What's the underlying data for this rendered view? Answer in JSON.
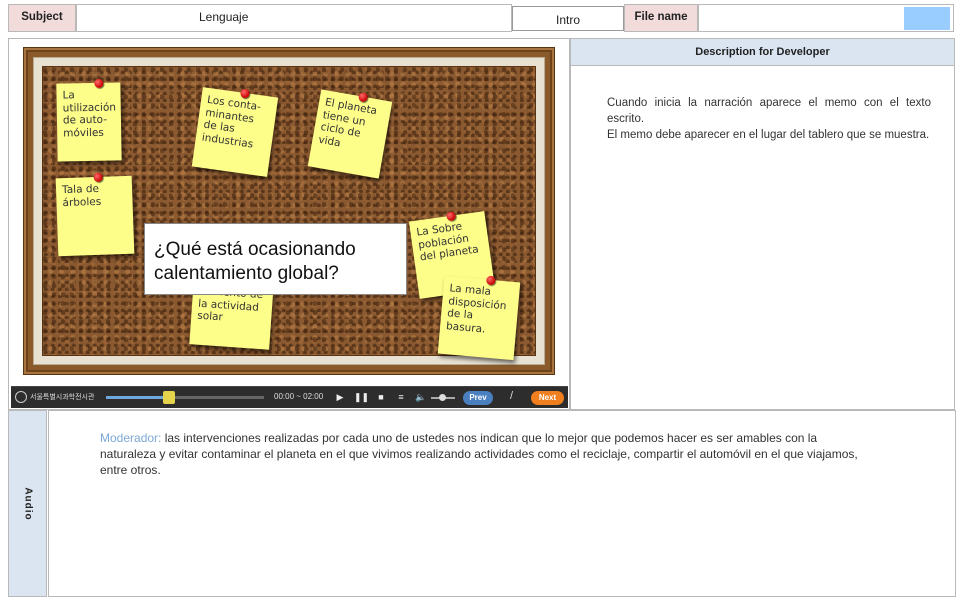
{
  "header": {
    "subject_label": "Subject",
    "subject_value": "Lenguaje",
    "intro": "Intro",
    "file_name_label": "File name",
    "file_name_value": ""
  },
  "description": {
    "title": "Description for Developer",
    "lines": [
      "Cuando inicia la narración aparece el memo con el texto escrito.",
      "El memo debe aparecer en el lugar del tablero que se muestra."
    ]
  },
  "board": {
    "question": "¿Qué está ocasionando calentamiento global?",
    "notes": [
      "La\nutilización\nde auto-\nmóviles",
      "Los conta-\nminantes\nde las\nindustrias",
      "El planeta\ntiene un\nciclo de\nvida",
      "Tala de\nárboles",
      "Aumento de\nla actividad\nsolar",
      "La Sobre\npoblación\ndel planeta",
      "La mala\ndisposición\nde la\nbasura."
    ]
  },
  "player": {
    "logo_text": "서울특별시과학전시관",
    "time": "00:00 ~ 02:00",
    "progress": 0.4,
    "prev_label": "Prev",
    "separator": "/",
    "next_label": "Next",
    "icons": [
      "play-icon",
      "pause-icon",
      "stop-icon",
      "list-icon",
      "volume-icon"
    ]
  },
  "audio": {
    "label": "Audio",
    "speaker": "Moderador:",
    "text": " las intervenciones realizadas por cada uno de ustedes nos indican que lo mejor que podemos hacer es ser amables con la naturaleza y evitar contaminar el planeta en el que vivimos realizando actividades como el reciclaje,  compartir el automóvil en el que viajamos, entre otros."
  },
  "colors": {
    "header_label_bg": "#f2dcdb",
    "panel_title_bg": "#dbe5f1",
    "sticky_note": "#fdfd8a",
    "next_button": "#f07f1f",
    "prev_button": "#4a80bf",
    "speaker_text": "#7ba7d6"
  }
}
